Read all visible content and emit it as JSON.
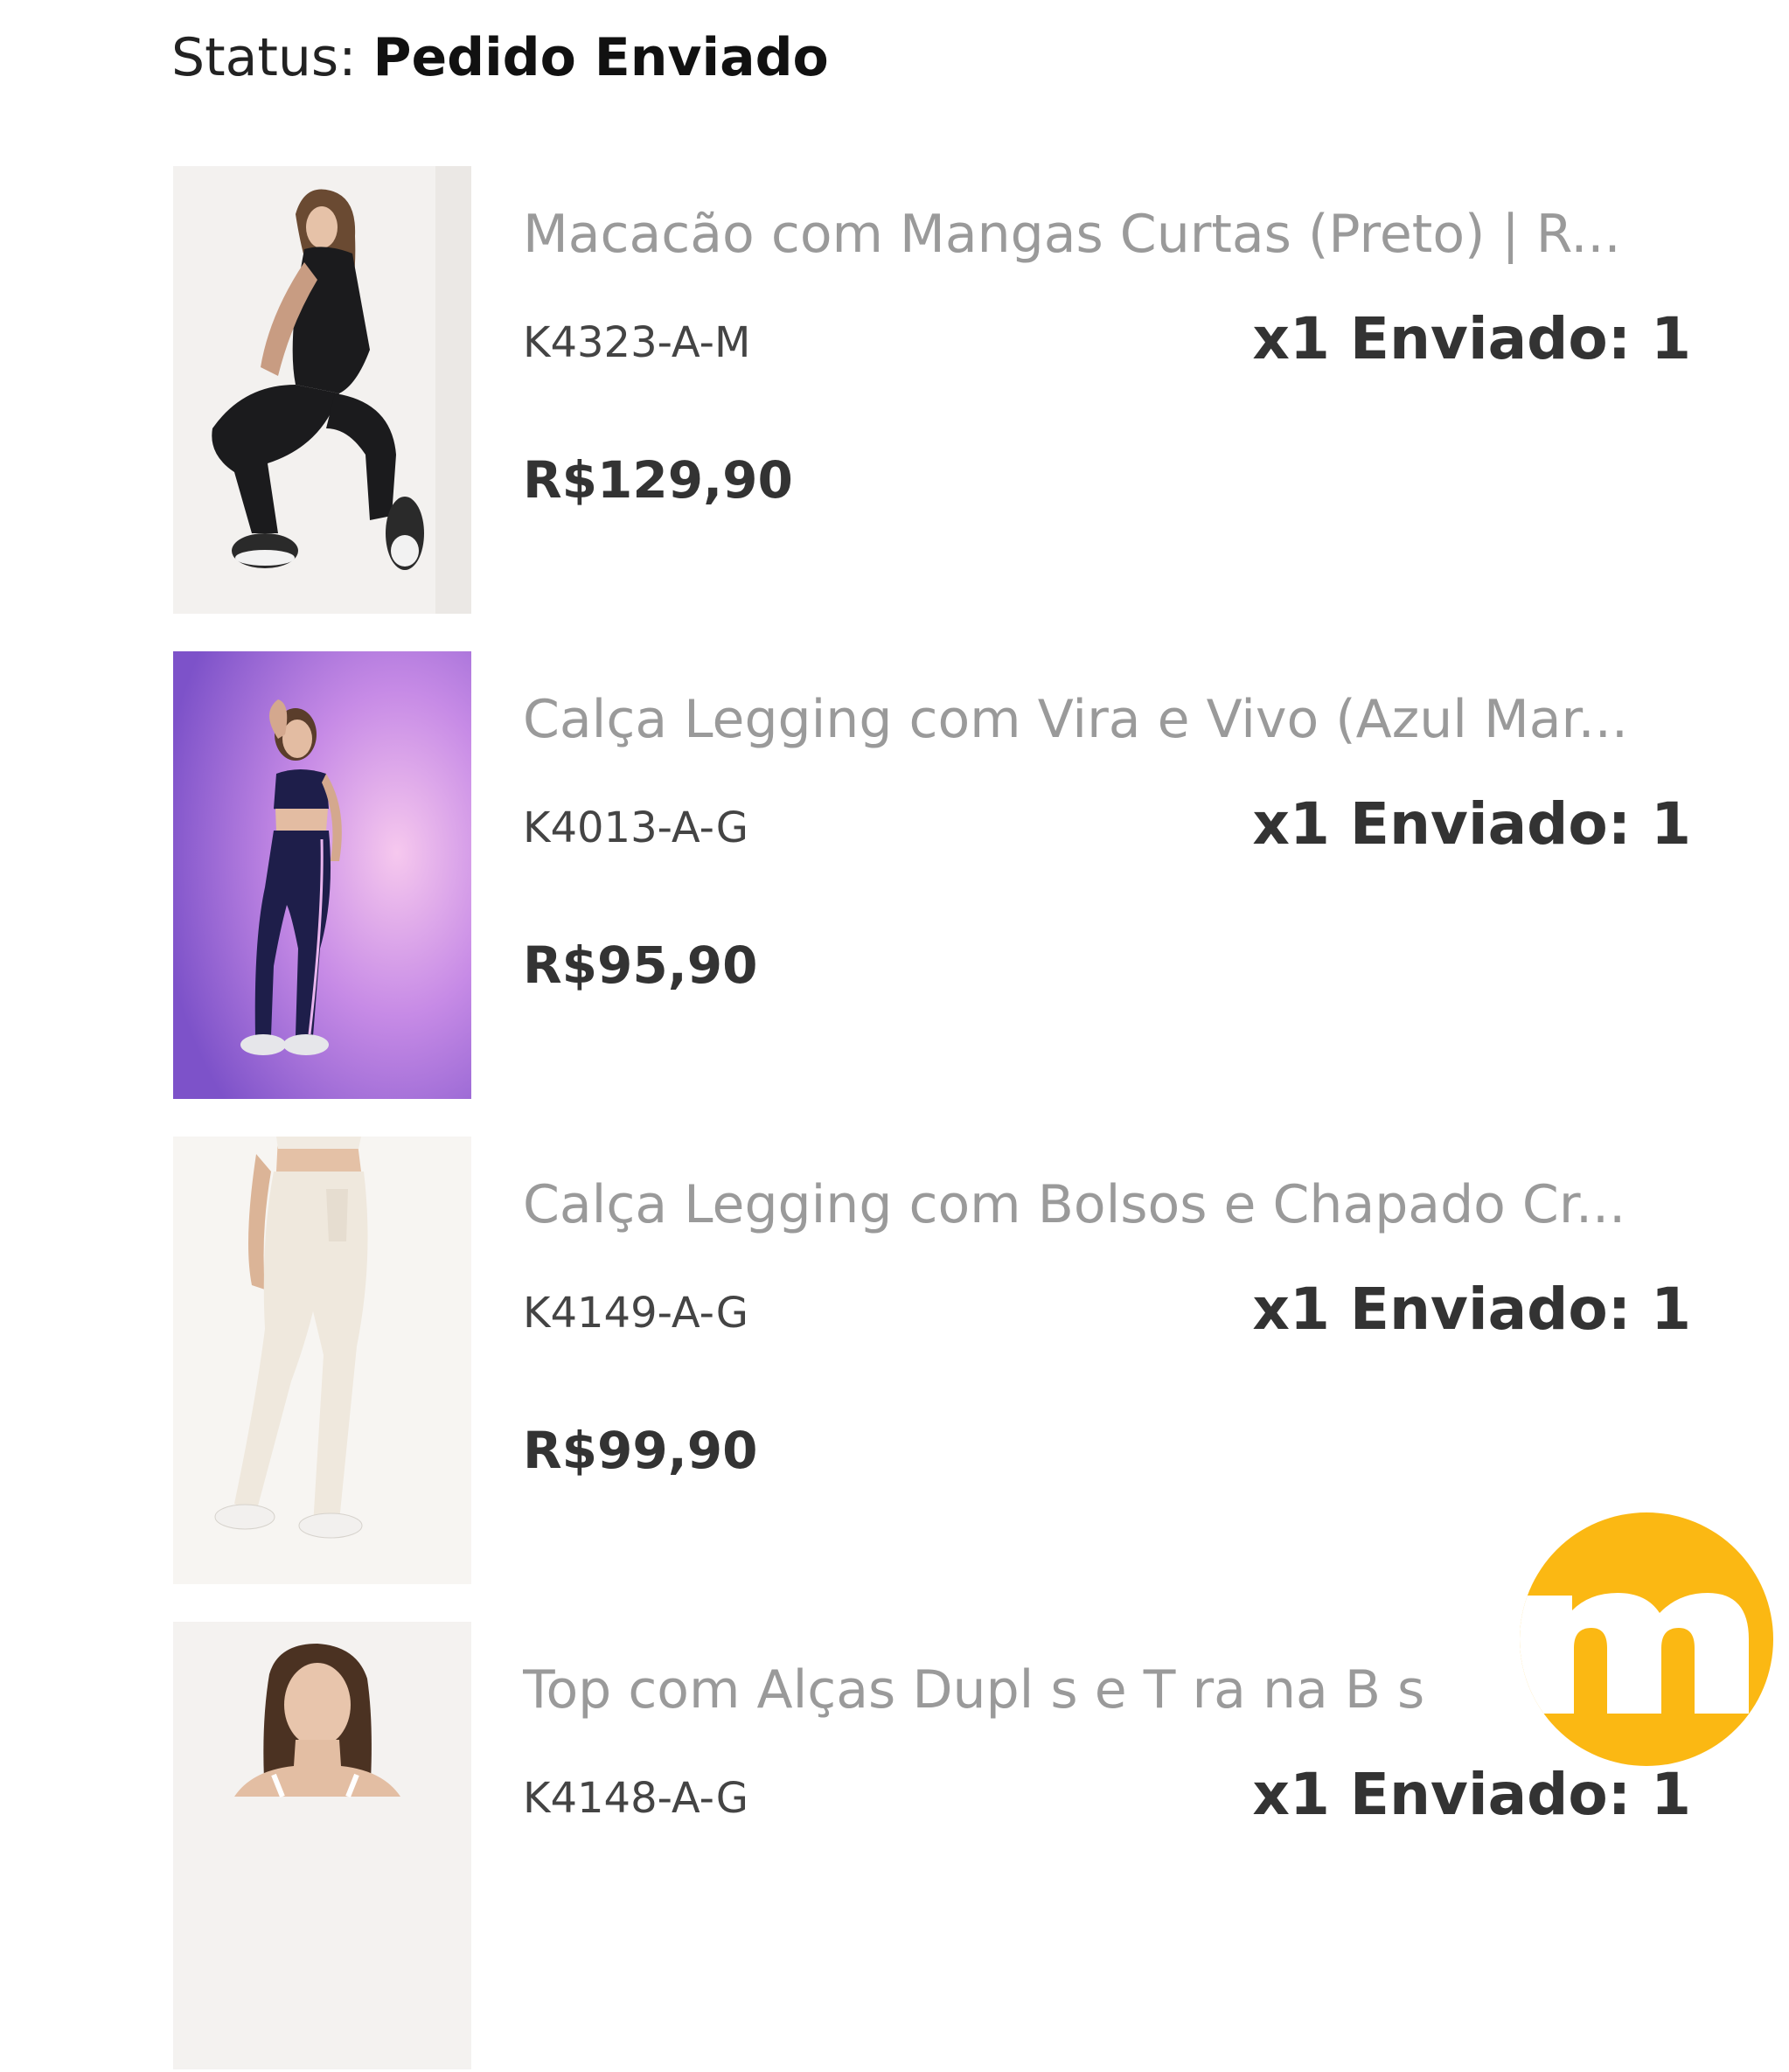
{
  "status": {
    "label": "Status:",
    "value": "Pedido Enviado"
  },
  "items": [
    {
      "name": "Macacão com Mangas Curtas (Preto) | R...",
      "sku": "K4323-A-M",
      "quantity": "x1 Enviado: 1",
      "price": "R$129,90",
      "image_background": "#f3f1ef",
      "garment_color": "#1b1b1d"
    },
    {
      "name": "Calça Legging com Vira e Vivo (Azul Mar...",
      "sku": "K4013-A-G",
      "quantity": "x1 Enviado: 1",
      "price": "R$95,90",
      "image_background": "#a06ad8",
      "garment_color": "#1e1e4a"
    },
    {
      "name": "Calça Legging com Bolsos e Chapado Cr...",
      "sku": "K4149-A-G",
      "quantity": "x1 Enviado: 1",
      "price": "R$99,90",
      "image_background": "#f7f5f2",
      "garment_color": "#efe8dd"
    },
    {
      "name": "Top com Alças Dupl s e T ra na B s",
      "sku": "K4148-A-G",
      "quantity": "x1 Enviado: 1",
      "price": "",
      "image_background": "#f4f2f0",
      "garment_color": "#ffffff"
    }
  ],
  "fab": {
    "letter": "m",
    "color": "#fbb813",
    "icon": "m-logo-icon"
  }
}
